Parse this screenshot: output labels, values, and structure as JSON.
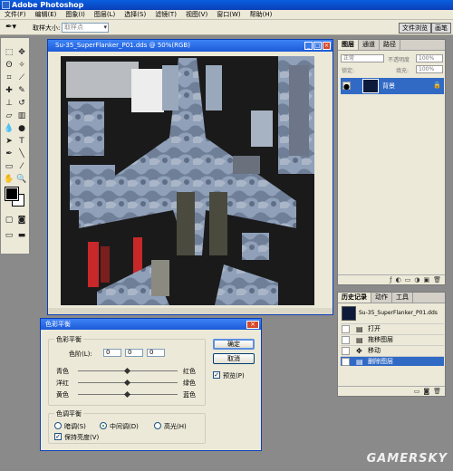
{
  "app": {
    "title": "Adobe Photoshop"
  },
  "menu": [
    "文件(F)",
    "编辑(E)",
    "图象(I)",
    "图层(L)",
    "选择(S)",
    "滤镜(T)",
    "视图(V)",
    "窗口(W)",
    "帮助(H)"
  ],
  "menu_tail": "",
  "options": {
    "label": "取样大小:",
    "sample_value": "取样点",
    "btn_file_browser": "文件浏览",
    "btn_brushes": "画笔"
  },
  "document": {
    "title": "Su-35_SuperFlanker_P01.dds @ 50%(RGB)"
  },
  "layers_panel": {
    "tabs": [
      "图层",
      "通道",
      "路径"
    ],
    "blend_mode": "正常",
    "opacity_label": "不透明度",
    "opacity_value": "100%",
    "lock_label": "锁定:",
    "fill_label": "填充:",
    "fill_value": "100%",
    "layer_name": "背景"
  },
  "history_panel": {
    "tabs": [
      "历史记录",
      "动作",
      "工具"
    ],
    "snapshot": "Su-35_SuperFlanker_P01.dds",
    "items": [
      "打开",
      "拖移图层",
      "移动",
      "删除图层"
    ],
    "active_index": 3
  },
  "dialog": {
    "title": "色彩平衡",
    "group_balance": "色彩平衡",
    "levels_label": "色阶(L):",
    "levels": [
      "0",
      "0",
      "0"
    ],
    "sliders": [
      {
        "left": "青色",
        "right": "红色",
        "value": 0
      },
      {
        "left": "洋红",
        "right": "绿色",
        "value": 0
      },
      {
        "left": "黄色",
        "right": "蓝色",
        "value": 0
      }
    ],
    "group_tone": "色调平衡",
    "tones": [
      "暗调(S)",
      "中间调(D)",
      "高光(H)"
    ],
    "tone_selected": "中间调(D)",
    "preserve_luminosity": "保持亮度(V)",
    "ok": "确定",
    "cancel": "取消",
    "preview": "预览(P)"
  },
  "watermark": "GAMERSKY",
  "colors": {
    "title_blue": "#0a3fb8",
    "selection_blue": "#316ac5",
    "chrome": "#ece9d8"
  }
}
